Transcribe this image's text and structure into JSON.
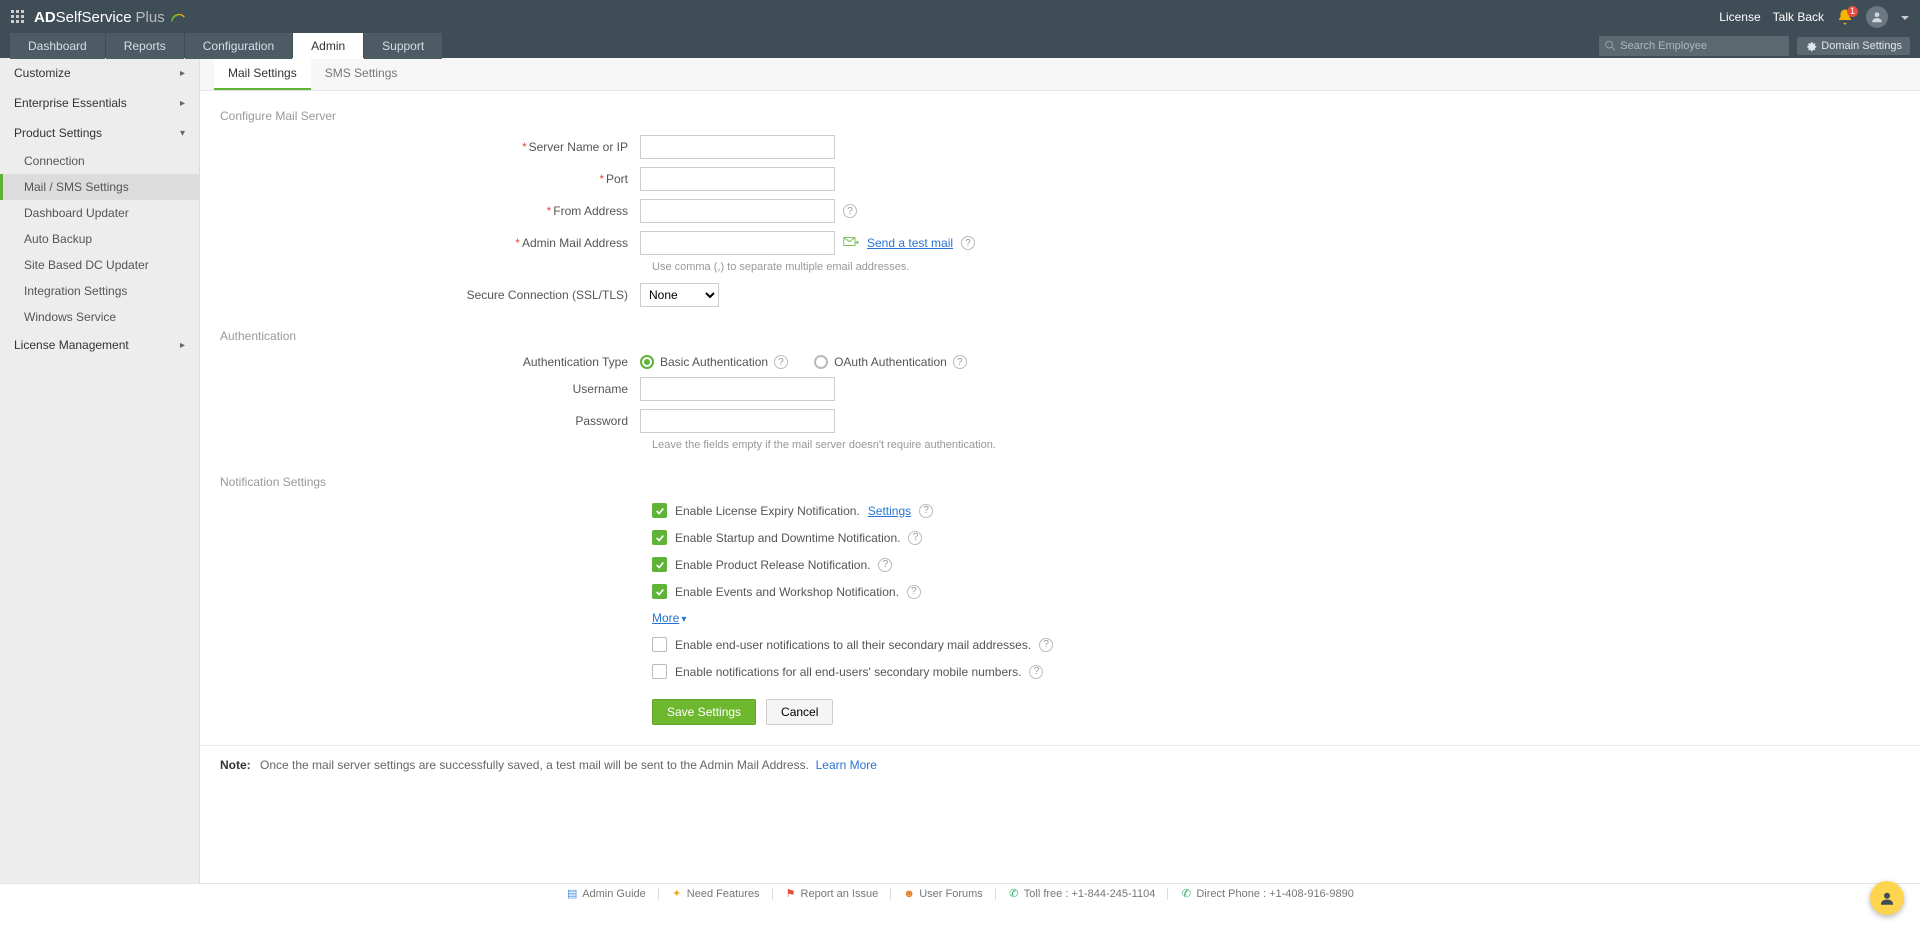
{
  "header": {
    "brand_prefix": "AD",
    "brand_main": "SelfService",
    "brand_suffix": "Plus",
    "license_link": "License",
    "talkback_link": "Talk Back",
    "notification_count": "1",
    "search_placeholder": "Search Employee",
    "domain_settings": "Domain Settings"
  },
  "mainnav": {
    "dashboard": "Dashboard",
    "reports": "Reports",
    "configuration": "Configuration",
    "admin": "Admin",
    "support": "Support"
  },
  "sidebar": {
    "customize": "Customize",
    "enterprise": "Enterprise Essentials",
    "product_settings": "Product Settings",
    "connection": "Connection",
    "mail_sms": "Mail / SMS Settings",
    "dashboard_updater": "Dashboard Updater",
    "auto_backup": "Auto Backup",
    "site_dc": "Site Based DC Updater",
    "integration": "Integration Settings",
    "windows_service": "Windows Service",
    "license_mgmt": "License Management"
  },
  "tabs": {
    "mail": "Mail Settings",
    "sms": "SMS Settings"
  },
  "sections": {
    "configure_mail": "Configure Mail Server",
    "authentication": "Authentication",
    "notification": "Notification Settings"
  },
  "labels": {
    "server_name": "Server Name or IP",
    "port": "Port",
    "from_address": "From Address",
    "admin_mail": "Admin Mail Address",
    "secure_conn": "Secure Connection (SSL/TLS)",
    "auth_type": "Authentication Type",
    "username": "Username",
    "password": "Password"
  },
  "auth_options": {
    "basic": "Basic Authentication",
    "oauth": "OAuth Authentication"
  },
  "hints": {
    "comma_separate": "Use comma (,) to separate multiple email addresses.",
    "leave_empty": "Leave the fields empty if the mail server doesn't require authentication."
  },
  "links": {
    "send_test": "Send a test mail",
    "settings": "Settings",
    "more": "More",
    "learn_more": "Learn More"
  },
  "select": {
    "secure_none": "None"
  },
  "checkboxes": {
    "license_expiry": "Enable License Expiry Notification.",
    "startup_downtime": "Enable Startup and Downtime Notification.",
    "product_release": "Enable Product Release Notification.",
    "events_workshop": "Enable Events and Workshop Notification.",
    "secondary_mail": "Enable end-user notifications to all their secondary mail addresses.",
    "secondary_mobile": "Enable notifications for all end-users' secondary mobile numbers."
  },
  "buttons": {
    "save": "Save Settings",
    "cancel": "Cancel"
  },
  "note": {
    "label": "Note:",
    "text": "Once the mail server settings are successfully saved, a test mail will be sent to the Admin Mail Address."
  },
  "footer": {
    "admin_guide": "Admin Guide",
    "need_features": "Need Features",
    "report_issue": "Report an Issue",
    "user_forums": "User Forums",
    "toll_free": "Toll free : +1-844-245-1104",
    "direct_phone": "Direct Phone : +1-408-916-9890"
  }
}
